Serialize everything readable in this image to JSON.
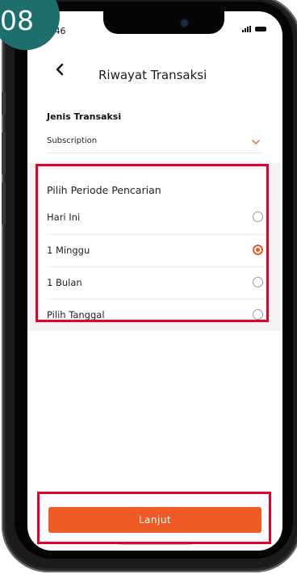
{
  "step_badge": {
    "label": "08",
    "color": "#1d6f6d"
  },
  "status_bar": {
    "time": ".46",
    "signal_icon": "cellular-signal-icon",
    "battery_icon": "battery-icon"
  },
  "header": {
    "back_icon": "chevron-left-icon",
    "title": "Riwayat Transaksi"
  },
  "transaction_type": {
    "label": "Jenis Transaksi",
    "selected_value": "Subscription",
    "dropdown_icon": "chevron-down-icon"
  },
  "period": {
    "title": "Pilih Periode Pencarian",
    "options": [
      {
        "label": "Hari Ini",
        "selected": false
      },
      {
        "label": "1 Minggu",
        "selected": true
      },
      {
        "label": "1 Bulan",
        "selected": false
      },
      {
        "label": "Pilih Tanggal",
        "selected": false
      }
    ]
  },
  "continue_button": {
    "label": "Lanjut"
  },
  "colors": {
    "accent": "#f05a24",
    "highlight_border": "#e3002b",
    "badge": "#1d6f6d"
  }
}
